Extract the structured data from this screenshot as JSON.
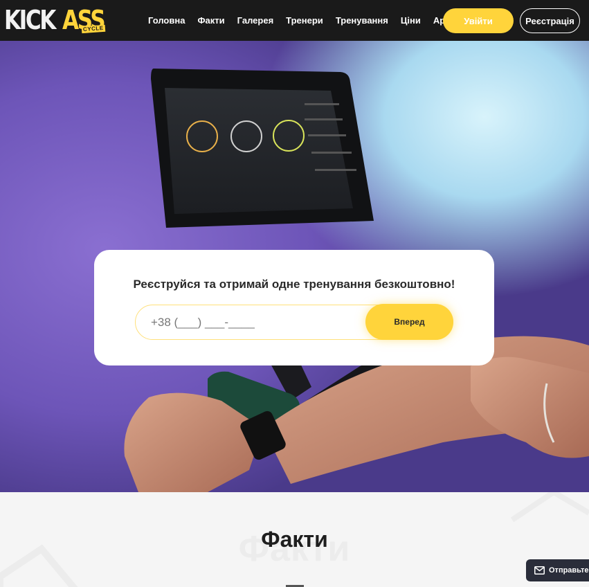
{
  "header": {
    "logo": {
      "main": "KICK",
      "accent": "ASS",
      "sub": "CYCLE"
    },
    "nav": [
      {
        "label": "Головна"
      },
      {
        "label": "Факти"
      },
      {
        "label": "Галерея"
      },
      {
        "label": "Тренери"
      },
      {
        "label": "Тренування"
      },
      {
        "label": "Ціни"
      },
      {
        "label": "App"
      }
    ],
    "login_label": "Увійти",
    "register_label": "Реєстрація"
  },
  "hero": {
    "card_title": "Реєструйся та отримай одне тренування безкоштовно!",
    "phone_placeholder": "+38 (___) ___-____",
    "submit_label": "Вперед"
  },
  "facts": {
    "watermark": "Факти",
    "title": "Факти"
  },
  "chat_widget": {
    "label": "Отправьте"
  },
  "colors": {
    "accent": "#ffd43b",
    "header_bg": "#1a1a1a",
    "hero_purple": "#6d55b8"
  }
}
